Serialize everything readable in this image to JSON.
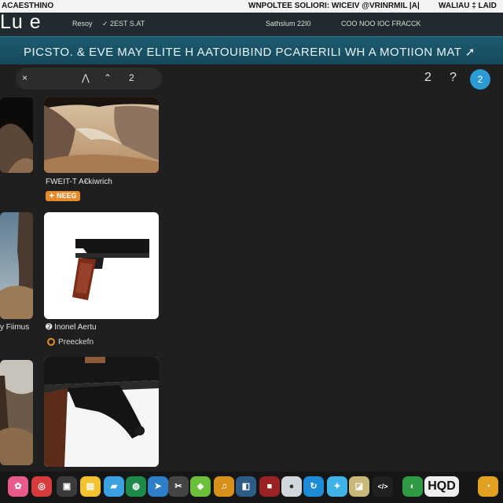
{
  "topbar": {
    "left_text": "ACAESTHINO",
    "right_text_1": "WNPOLTEE SOLIORI: WICEIV @VRINRMIL |A|",
    "right_text_2": "WALIAU ‡ LAID"
  },
  "header": {
    "logo": "Lu e",
    "nav_item_1": "Resoy",
    "nav_item_2": "✓ 2EST S.AT",
    "status_1": "Sathslum 22I0",
    "status_2": "COO NOO IOC FRACCK"
  },
  "banner": {
    "text": "PICSTO. & EVE MAY ELITE H AATOUIBIND PCARERILI WH A MOTIION MAT ➚"
  },
  "toolbar": {
    "close_glyph": "×",
    "tool_a": "⋀",
    "tool_b": "⌃",
    "tool_c": "2",
    "right_num": "2",
    "help": "?",
    "action_btn": "2"
  },
  "cards": {
    "card1_caption": "FWEIT-T A€kiwrich",
    "card1_tag": "✦ NEEG",
    "card2_caption": "➋ Inonel Aertu",
    "card2_sub": "Preeckefn",
    "left2_caption": "y Fiimus"
  },
  "dock": {
    "icons": [
      "flower-icon",
      "target-icon",
      "terminal-icon",
      "notes-icon",
      "folder-icon",
      "globe-icon",
      "compass-icon",
      "tools-icon",
      "maps-icon",
      "music-icon",
      "photo-icon",
      "stop-icon",
      "circle-icon",
      "sync-icon",
      "twitter-icon",
      "preview-icon",
      "code-icon",
      "globe2-icon",
      "text-icon",
      "clock-icon"
    ],
    "label_hq": "HQ",
    "label_d": "D"
  }
}
